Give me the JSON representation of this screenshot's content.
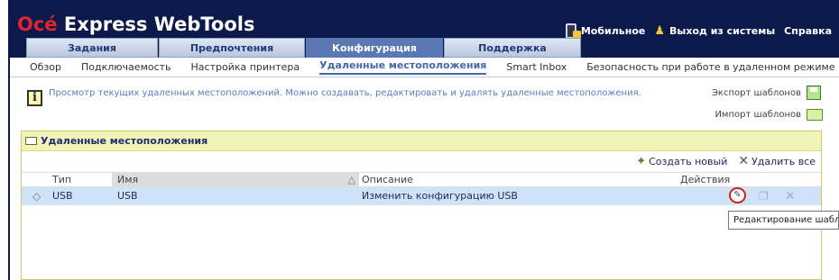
{
  "app": {
    "logo_brand": "Océ",
    "logo_rest": " Express WebTools"
  },
  "top_links": {
    "mobile": "Мобильное",
    "logout": "Выход из системы",
    "help": "Справка"
  },
  "tabs": [
    {
      "label": "Задания"
    },
    {
      "label": "Предпочтения"
    },
    {
      "label": "Конфигурация"
    },
    {
      "label": "Поддержка"
    }
  ],
  "subnav": [
    {
      "label": "Обзор"
    },
    {
      "label": "Подключаемость"
    },
    {
      "label": "Настройка принтера"
    },
    {
      "label": "Удаленные местоположения"
    },
    {
      "label": "Smart Inbox"
    },
    {
      "label": "Безопасность при работе в удаленном режиме"
    }
  ],
  "info": {
    "text": "Просмотр текущих удаленных местоположений. Можно создавать, редактировать и удалять удаленные местоположения."
  },
  "templates": {
    "export_label": "Экспорт шаблонов",
    "import_label": "Импорт шаблонов"
  },
  "panel": {
    "title": "Удаленные местоположения",
    "create_label": "Создать новый",
    "delete_all_label": "Удалить все"
  },
  "table": {
    "headers": {
      "type": "Тип",
      "name": "Имя",
      "description": "Описание",
      "actions": "Действия"
    },
    "rows": [
      {
        "type": "USB",
        "name": "USB",
        "description": "Изменить конфигурацию USB"
      }
    ]
  },
  "tooltip": {
    "text": "Редактирование шаблона"
  },
  "colors": {
    "top_bar": "#0b1a4a",
    "brand_red": "#e3232d",
    "active_tab": "#5a78b4",
    "panel_header": "#f1f3b8",
    "selected_row": "#cfe3f8"
  }
}
